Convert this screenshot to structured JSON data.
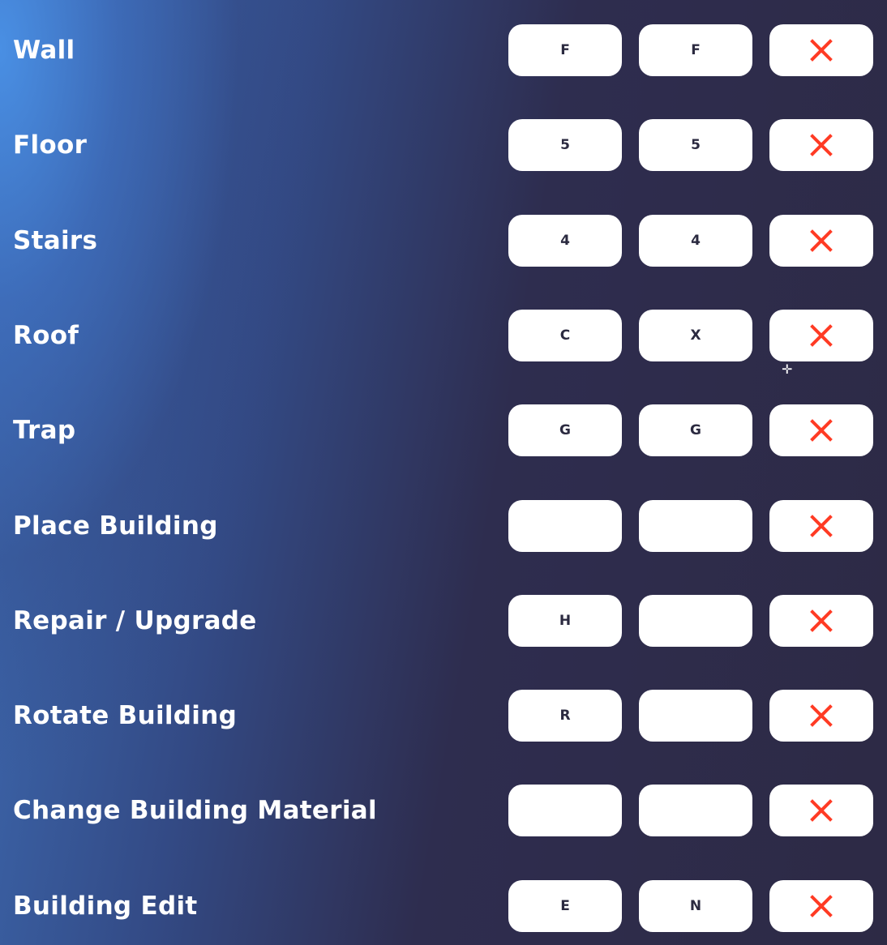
{
  "colors": {
    "clear_icon": "#ff3b24",
    "key_text": "#2b2a40"
  },
  "bindings": [
    {
      "action": "Wall",
      "primary": "F",
      "secondary": "F"
    },
    {
      "action": "Floor",
      "primary": "5",
      "secondary": "5"
    },
    {
      "action": "Stairs",
      "primary": "4",
      "secondary": "4"
    },
    {
      "action": "Roof",
      "primary": "C",
      "secondary": "X"
    },
    {
      "action": "Trap",
      "primary": "G",
      "secondary": "G"
    },
    {
      "action": "Place Building",
      "primary": "",
      "secondary": ""
    },
    {
      "action": "Repair / Upgrade",
      "primary": "H",
      "secondary": ""
    },
    {
      "action": "Rotate Building",
      "primary": "R",
      "secondary": ""
    },
    {
      "action": "Change Building Material",
      "primary": "",
      "secondary": ""
    },
    {
      "action": "Building Edit",
      "primary": "E",
      "secondary": "N"
    }
  ],
  "clear_icon": "close-x-icon"
}
